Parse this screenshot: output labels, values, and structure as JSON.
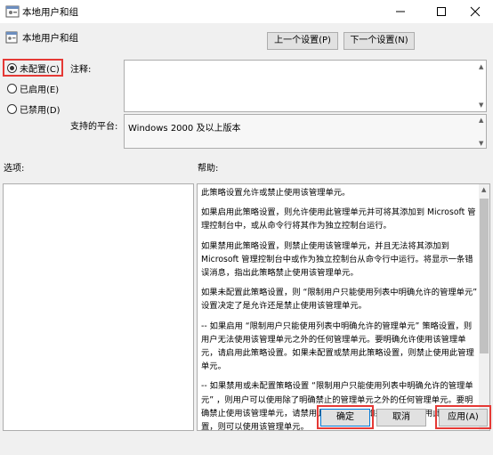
{
  "window": {
    "title": "本地用户和组",
    "min_icon": "minimize-icon",
    "max_icon": "maximize-icon",
    "close_icon": "close-icon"
  },
  "header": {
    "title": "本地用户和组",
    "prev_button": "上一个设置(P)",
    "next_button": "下一个设置(N)"
  },
  "options": {
    "items": [
      {
        "label": "未配置(C)",
        "checked": true
      },
      {
        "label": "已启用(E)",
        "checked": false
      },
      {
        "label": "已禁用(D)",
        "checked": false
      }
    ]
  },
  "comment": {
    "label": "注释:",
    "value": ""
  },
  "platform": {
    "label": "支持的平台:",
    "value": "Windows 2000 及以上版本"
  },
  "options_section": {
    "label": "选项:"
  },
  "help_section": {
    "label": "帮助:",
    "paragraphs": [
      "此策略设置允许或禁止使用该管理单元。",
      "如果启用此策略设置，则允许使用此管理单元并可将其添加到 Microsoft 管理控制台中，或从命令行将其作为独立控制台运行。",
      "如果禁用此策略设置，则禁止使用该管理单元，并且无法将其添加到 Microsoft 管理控制台中或作为独立控制台从命令行中运行。将显示一条错误消息，指出此策略禁止使用该管理单元。",
      "如果未配置此策略设置，则 “限制用户只能使用列表中明确允许的管理单元” 设置决定了是允许还是禁止使用该管理单元。",
      "-- 如果启用 “限制用户只能使用列表中明确允许的管理单元” 策略设置，则用户无法使用该管理单元之外的任何管理单元。要明确允许使用该管理单元，请启用此策略设置。如果未配置或禁用此策略设置，则禁止使用此管理单元。",
      "-- 如果禁用或未配置策略设置 “限制用户只能使用列表中明确允许的管理单元” ，则用户可以使用除了明确禁止的管理单元之外的任何管理单元。要明确禁止使用该管理单元，请禁用此策略设置。如果未配置或启用此策略设置，则可以使用该管理单元。"
    ]
  },
  "footer": {
    "ok": "确定",
    "cancel": "取消",
    "apply": "应用(A)"
  },
  "colors": {
    "highlight": "#e53935",
    "window_bg": "#f0f0f0"
  }
}
